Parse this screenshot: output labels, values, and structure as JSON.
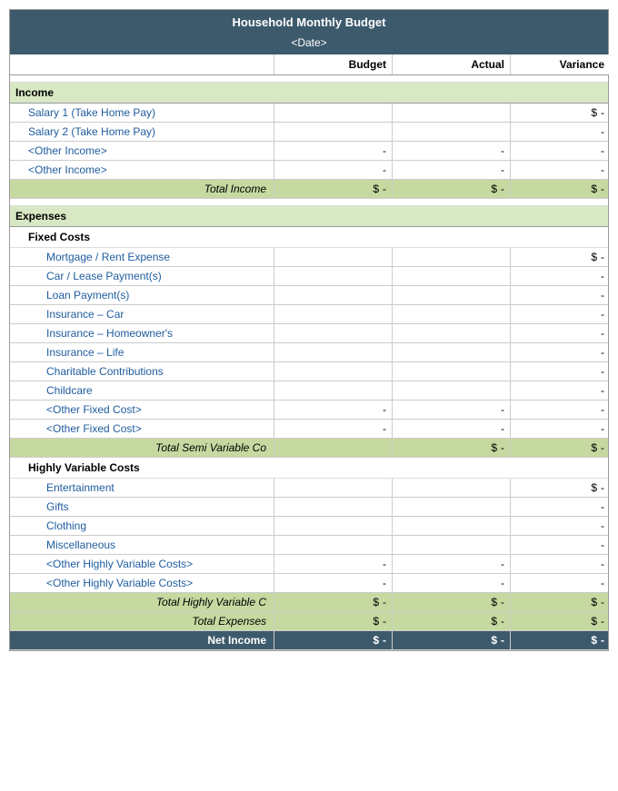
{
  "header": {
    "title": "Household Monthly Budget",
    "date": "<Date>"
  },
  "columns": {
    "label": "",
    "budget": "Budget",
    "actual": "Actual",
    "variance": "Variance"
  },
  "income": {
    "section_label": "Income",
    "rows": [
      {
        "label": "Salary 1 (Take Home Pay)",
        "budget": "",
        "actual": "",
        "variance_dollar": "$",
        "variance": "-"
      },
      {
        "label": "Salary 2 (Take Home Pay)",
        "budget": "",
        "actual": "",
        "variance_dollar": "",
        "variance": "-"
      },
      {
        "label": "<Other Income>",
        "budget": "-",
        "actual": "-",
        "variance_dollar": "",
        "variance": "-"
      },
      {
        "label": "<Other Income>",
        "budget": "-",
        "actual": "-",
        "variance_dollar": "",
        "variance": "-"
      }
    ],
    "total_label": "Total Income",
    "total": {
      "budget_dollar": "$",
      "budget": "-",
      "actual_dollar": "$",
      "actual": "-",
      "variance_dollar": "$",
      "variance": "-"
    }
  },
  "expenses": {
    "section_label": "Expenses",
    "fixed_costs": {
      "label": "Fixed Costs",
      "rows": [
        {
          "label": "Mortgage / Rent Expense",
          "budget": "",
          "actual": "",
          "variance_dollar": "$",
          "variance": "-"
        },
        {
          "label": "Car / Lease Payment(s)",
          "budget": "",
          "actual": "",
          "variance_dollar": "",
          "variance": "-"
        },
        {
          "label": "Loan Payment(s)",
          "budget": "",
          "actual": "",
          "variance_dollar": "",
          "variance": "-"
        },
        {
          "label": "Insurance – Car",
          "budget": "",
          "actual": "",
          "variance_dollar": "",
          "variance": "-"
        },
        {
          "label": "Insurance – Homeowner's",
          "budget": "",
          "actual": "",
          "variance_dollar": "",
          "variance": "-"
        },
        {
          "label": "Insurance – Life",
          "budget": "",
          "actual": "",
          "variance_dollar": "",
          "variance": "-"
        },
        {
          "label": "Charitable Contributions",
          "budget": "",
          "actual": "",
          "variance_dollar": "",
          "variance": "-"
        },
        {
          "label": "Childcare",
          "budget": "",
          "actual": "",
          "variance_dollar": "",
          "variance": "-"
        },
        {
          "label": "<Other Fixed Cost>",
          "budget": "-",
          "actual": "-",
          "variance_dollar": "",
          "variance": "-"
        },
        {
          "label": "<Other Fixed Cost>",
          "budget": "-",
          "actual": "-",
          "variance_dollar": "",
          "variance": "-"
        }
      ],
      "total_label": "Total Semi Variable Co",
      "total": {
        "budget_dollar": "",
        "budget": "",
        "actual_dollar": "$",
        "actual": "-",
        "variance_dollar": "$",
        "variance": "-"
      }
    },
    "highly_variable": {
      "label": "Highly Variable Costs",
      "rows": [
        {
          "label": "Entertainment",
          "budget": "",
          "actual": "",
          "variance_dollar": "$",
          "variance": "-"
        },
        {
          "label": "Gifts",
          "budget": "",
          "actual": "",
          "variance_dollar": "",
          "variance": "-"
        },
        {
          "label": "Clothing",
          "budget": "",
          "actual": "",
          "variance_dollar": "",
          "variance": "-"
        },
        {
          "label": "Miscellaneous",
          "budget": "",
          "actual": "",
          "variance_dollar": "",
          "variance": "-"
        },
        {
          "label": "<Other Highly Variable Costs>",
          "budget": "-",
          "actual": "-",
          "variance_dollar": "",
          "variance": "-"
        },
        {
          "label": "<Other Highly Variable Costs>",
          "budget": "-",
          "actual": "-",
          "variance_dollar": "",
          "variance": "-"
        }
      ],
      "total_hv_label": "Total Highly Variable C",
      "total_hv": {
        "budget_dollar": "$",
        "budget": "-",
        "actual_dollar": "$",
        "actual": "-",
        "variance_dollar": "$",
        "variance": "-"
      },
      "total_exp_label": "Total Expenses",
      "total_exp": {
        "budget_dollar": "$",
        "budget": "-",
        "actual_dollar": "$",
        "actual": "-",
        "variance_dollar": "$",
        "variance": "-"
      }
    }
  },
  "net_income": {
    "label": "Net Income",
    "budget_dollar": "$",
    "budget": "-",
    "actual_dollar": "$",
    "actual": "-",
    "variance_dollar": "$",
    "variance": "-"
  }
}
